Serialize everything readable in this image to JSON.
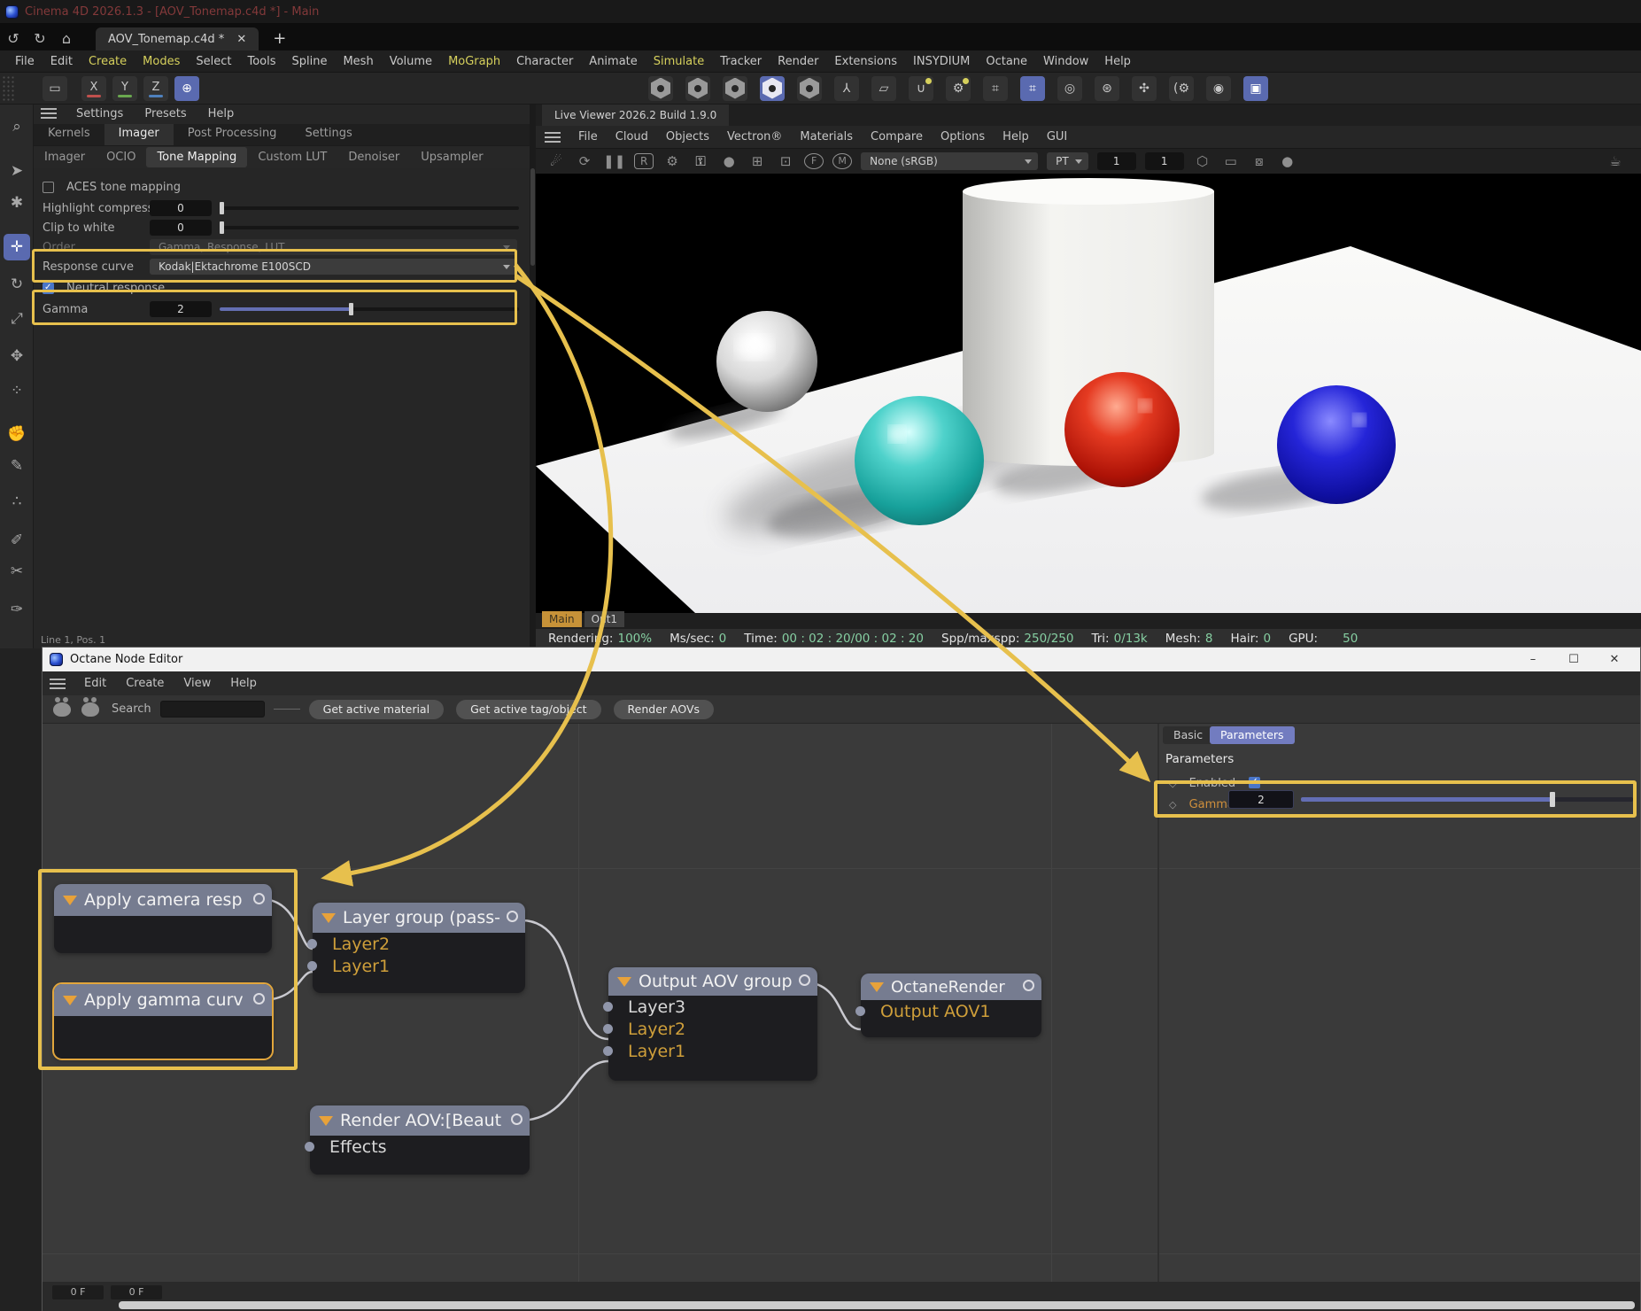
{
  "colors": {
    "annotation_yellow": "#e7c04d",
    "selection_blue": "#5a6ab0",
    "value_green": "#86cfa2",
    "node_orange": "#cf9f3a",
    "param_tab_blue": "#727cc0"
  },
  "titlebar": {
    "title": "Cinema 4D 2026.1.3 - [AOV_Tonemap.c4d *] - Main"
  },
  "tabbar": {
    "undo": "↺",
    "redo": "↻",
    "home": "⌂",
    "tab_label": "AOV_Tonemap.c4d *",
    "close": "✕",
    "add": "+"
  },
  "main_menu": [
    {
      "label": "File",
      "hl": false
    },
    {
      "label": "Edit",
      "hl": false
    },
    {
      "label": "Create",
      "hl": true
    },
    {
      "label": "Modes",
      "hl": true
    },
    {
      "label": "Select",
      "hl": false
    },
    {
      "label": "Tools",
      "hl": false
    },
    {
      "label": "Spline",
      "hl": false
    },
    {
      "label": "Mesh",
      "hl": false
    },
    {
      "label": "Volume",
      "hl": false
    },
    {
      "label": "MoGraph",
      "hl": true
    },
    {
      "label": "Character",
      "hl": false
    },
    {
      "label": "Animate",
      "hl": false
    },
    {
      "label": "Simulate",
      "hl": true
    },
    {
      "label": "Tracker",
      "hl": false
    },
    {
      "label": "Render",
      "hl": false
    },
    {
      "label": "Extensions",
      "hl": false
    },
    {
      "label": "INSYDIUM",
      "hl": false
    },
    {
      "label": "Octane",
      "hl": false
    },
    {
      "label": "Window",
      "hl": false
    },
    {
      "label": "Help",
      "hl": false
    }
  ],
  "axis_toolbar": {
    "box": "▭",
    "x": "X",
    "y": "Y",
    "z": "Z",
    "x_color": "#c0504d",
    "y_color": "#6aa84f",
    "z_color": "#4f81bd"
  },
  "mode_toolbar": [
    {
      "name": "points-mode-icon",
      "type": "hex",
      "active": false
    },
    {
      "name": "edges-mode-icon",
      "type": "hex",
      "active": false
    },
    {
      "name": "polygons-mode-icon",
      "type": "hex",
      "active": false
    },
    {
      "name": "model-mode-icon",
      "type": "hex",
      "active": true
    },
    {
      "name": "texture-mode-icon",
      "type": "hex",
      "active": false
    },
    {
      "name": "axis-mode-icon",
      "type": "glyph",
      "glyph": "⅄",
      "active": false
    },
    {
      "name": "workplane-icon",
      "type": "glyph",
      "glyph": "▱",
      "active": false
    },
    {
      "name": "snap-magnet-icon",
      "type": "glyph",
      "glyph": "∪",
      "dot": true,
      "active": false
    },
    {
      "name": "snap-settings-icon",
      "type": "glyph",
      "glyph": "⚙",
      "dot": true,
      "active": false
    },
    {
      "name": "grid-icon",
      "type": "glyph",
      "glyph": "⌗",
      "active": false
    },
    {
      "name": "grid-lock-icon",
      "type": "glyph",
      "glyph": "⌗",
      "active": true
    },
    {
      "name": "target-icon",
      "type": "glyph",
      "glyph": "◎",
      "active": false
    },
    {
      "name": "gear-circle-icon",
      "type": "glyph",
      "glyph": "⊛",
      "active": false
    },
    {
      "name": "symmetry-icon",
      "type": "glyph",
      "glyph": "✣",
      "active": false
    },
    {
      "name": "tweak-gear-icon",
      "type": "glyph",
      "glyph": "(⚙",
      "active": false
    },
    {
      "name": "viewport-eye-icon",
      "type": "glyph",
      "glyph": "◉",
      "active": false
    },
    {
      "name": "render-settings-icon",
      "type": "glyph",
      "glyph": "▣",
      "active": true
    }
  ],
  "left_rail": [
    {
      "name": "zoom-tool-icon",
      "glyph": "⌕",
      "sel": false
    },
    {
      "name": "select-tool-icon",
      "glyph": "➤",
      "sel": false
    },
    {
      "name": "tool-settings-icon",
      "glyph": "✱",
      "sel": false
    },
    {
      "name": "move-tool-icon",
      "glyph": "✛",
      "sel": true
    },
    {
      "name": "rotate-tool-icon",
      "glyph": "↻",
      "sel": false
    },
    {
      "name": "scale-tool-icon",
      "glyph": "⤢",
      "sel": false
    },
    {
      "name": "transform-tool-icon",
      "glyph": "✥",
      "sel": false
    },
    {
      "name": "scatter-tool-icon",
      "glyph": "⁘",
      "sel": false
    },
    {
      "name": "grab-tool-icon",
      "glyph": "✊",
      "sel": false
    },
    {
      "name": "pencil-tool-icon",
      "glyph": "✎",
      "sel": false
    },
    {
      "name": "paint-dots-icon",
      "glyph": "∴",
      "sel": false
    },
    {
      "name": "brush-tool-icon",
      "glyph": "✐",
      "sel": false
    },
    {
      "name": "knife-tool-icon",
      "glyph": "✂",
      "sel": false
    },
    {
      "name": "spline-pen-icon",
      "glyph": "✑",
      "sel": false
    }
  ],
  "settings_panel": {
    "menu": [
      "Settings",
      "Presets",
      "Help"
    ],
    "tabs": [
      {
        "label": "Kernels",
        "on": false
      },
      {
        "label": "Imager",
        "on": true
      },
      {
        "label": "Post Processing",
        "on": false
      },
      {
        "label": "Settings",
        "on": false
      }
    ],
    "subtabs": [
      {
        "label": "Imager",
        "on": false
      },
      {
        "label": "OCIO",
        "on": false
      },
      {
        "label": "Tone Mapping",
        "on": true
      },
      {
        "label": "Custom LUT",
        "on": false
      },
      {
        "label": "Denoiser",
        "on": false
      },
      {
        "label": "Upsampler",
        "on": false
      }
    ],
    "aces_label": "ACES tone mapping",
    "highlight_label": "Highlight compression",
    "highlight_value": "0",
    "clip_label": "Clip to white",
    "clip_value": "0",
    "order_label": "Order",
    "order_value": "Gamma, Response, LUT",
    "response_label": "Response curve",
    "response_value": "Kodak|Ektachrome E100SCD",
    "neutral_label": "Neutral response",
    "gamma_label": "Gamma",
    "gamma_value": "2",
    "statusline": "Line 1, Pos. 1"
  },
  "live_viewer": {
    "tab_title": "Live Viewer 2026.2 Build 1.9.0",
    "menu": [
      "File",
      "Cloud",
      "Objects",
      "Vectron®",
      "Materials",
      "Compare",
      "Options",
      "Help",
      "GUI"
    ],
    "toolbar": {
      "colorspace": "None (sRGB)",
      "mode": "PT",
      "samples_field": "1",
      "subsamples_field": "1",
      "r_button": "R",
      "f_button": "F",
      "m_button": "M"
    },
    "view_tabs": [
      {
        "label": "Main",
        "active": true
      },
      {
        "label": "Out1",
        "active": false
      }
    ],
    "status": [
      {
        "label": "Rendering:",
        "value": "100%"
      },
      {
        "label": "Ms/sec:",
        "value": "0"
      },
      {
        "label": "Time:",
        "value": "00 : 02 : 20/00 : 02 : 20"
      },
      {
        "label": "Spp/maxspp:",
        "value": "250/250"
      },
      {
        "label": "Tri:",
        "value": "0/13k"
      },
      {
        "label": "Mesh:",
        "value": "8"
      },
      {
        "label": "Hair:",
        "value": "0"
      },
      {
        "label": "GPU:",
        "value": "50"
      }
    ]
  },
  "node_editor": {
    "window_title": "Octane Node Editor",
    "window_buttons": {
      "minimize": "–",
      "maximize": "☐",
      "close": "✕"
    },
    "menu": [
      "Edit",
      "Create",
      "View",
      "Help"
    ],
    "search_label": "Search",
    "buttons": [
      "Get active material",
      "Get active tag/object",
      "Render AOVs"
    ],
    "nodes": [
      {
        "title": "Apply camera resp",
        "ports": []
      },
      {
        "title": "Apply gamma curv",
        "ports": []
      },
      {
        "title": "Layer group (pass-",
        "ports": [
          {
            "label": "Layer2",
            "orange": true
          },
          {
            "label": "Layer1",
            "orange": true
          }
        ]
      },
      {
        "title": "Output AOV group",
        "ports": [
          {
            "label": "Layer3",
            "orange": false
          },
          {
            "label": "Layer2",
            "orange": true
          },
          {
            "label": "Layer1",
            "orange": true
          }
        ]
      },
      {
        "title": "OctaneRender",
        "ports": [
          {
            "label": "Output AOV1",
            "orange": true
          }
        ]
      },
      {
        "title": "Render AOV:[Beaut",
        "ports": [
          {
            "label": "Effects",
            "orange": false
          }
        ]
      }
    ],
    "right_panel": {
      "tab_basic": "Basic",
      "tab_parameters": "Parameters",
      "heading": "Parameters",
      "enabled_label": "Enabled",
      "gamma_label": "Gamma",
      "gamma_value": "2"
    },
    "frame_box_1": "0 F",
    "frame_box_2": "0 F"
  }
}
